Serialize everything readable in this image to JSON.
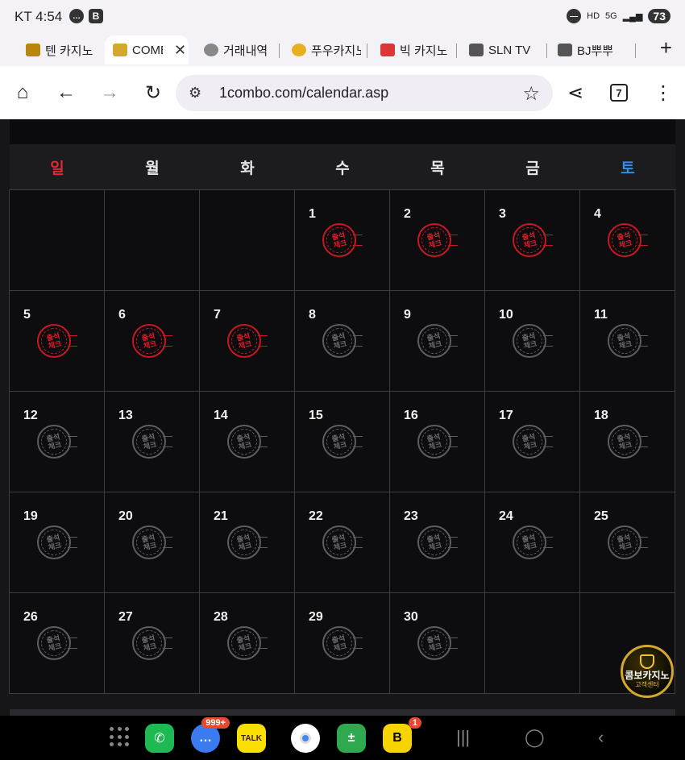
{
  "statusbar": {
    "time": "KT 4:54",
    "battery": "73",
    "network": "5G"
  },
  "tabs": [
    {
      "label": "텐 카지노",
      "color": "#b8860b"
    },
    {
      "label": "COMBO",
      "color": "#d4a82a",
      "active": true
    },
    {
      "label": "거래내역",
      "color": "#888888"
    },
    {
      "label": "푸우카지노",
      "color": "#e8b020"
    },
    {
      "label": "빅 카지노",
      "color": "#d93636"
    },
    {
      "label": "SLN TV",
      "color": "#555555"
    },
    {
      "label": "BJ뿌뿌",
      "color": "#555555"
    }
  ],
  "toolbar": {
    "url": "1combo.com/calendar.asp",
    "tab_count": "7"
  },
  "calendar": {
    "weekdays": [
      "일",
      "월",
      "화",
      "수",
      "목",
      "금",
      "토"
    ],
    "stamp_line1": "출석",
    "stamp_line2": "체크",
    "cells": [
      {
        "day": "",
        "checked": false
      },
      {
        "day": "",
        "checked": false
      },
      {
        "day": "",
        "checked": false
      },
      {
        "day": "1",
        "checked": true
      },
      {
        "day": "2",
        "checked": true
      },
      {
        "day": "3",
        "checked": true
      },
      {
        "day": "4",
        "checked": true
      },
      {
        "day": "5",
        "checked": true
      },
      {
        "day": "6",
        "checked": true
      },
      {
        "day": "7",
        "checked": true
      },
      {
        "day": "8",
        "checked": false
      },
      {
        "day": "9",
        "checked": false
      },
      {
        "day": "10",
        "checked": false
      },
      {
        "day": "11",
        "checked": false
      },
      {
        "day": "12",
        "checked": false
      },
      {
        "day": "13",
        "checked": false
      },
      {
        "day": "14",
        "checked": false
      },
      {
        "day": "15",
        "checked": false
      },
      {
        "day": "16",
        "checked": false
      },
      {
        "day": "17",
        "checked": false
      },
      {
        "day": "18",
        "checked": false
      },
      {
        "day": "19",
        "checked": false
      },
      {
        "day": "20",
        "checked": false
      },
      {
        "day": "21",
        "checked": false
      },
      {
        "day": "22",
        "checked": false
      },
      {
        "day": "23",
        "checked": false
      },
      {
        "day": "24",
        "checked": false
      },
      {
        "day": "25",
        "checked": false
      },
      {
        "day": "26",
        "checked": false
      },
      {
        "day": "27",
        "checked": false
      },
      {
        "day": "28",
        "checked": false
      },
      {
        "day": "29",
        "checked": false
      },
      {
        "day": "30",
        "checked": false
      },
      {
        "day": "",
        "checked": false
      },
      {
        "day": "",
        "checked": false
      }
    ],
    "colors": {
      "sunday": "#e0282e",
      "saturday": "#2f8ef0",
      "stamp_checked": "#c51823"
    }
  },
  "support_badge": {
    "line1": "콤보카지노",
    "line2": "고객센터"
  },
  "navbar": {
    "messages_badge": "999+",
    "bapp_badge": "1",
    "apps": [
      "phone-icon",
      "messages-icon",
      "kakaotalk-icon",
      "chrome-icon",
      "calculator-icon",
      "b-app-icon"
    ],
    "kakao_label": "TALK"
  }
}
